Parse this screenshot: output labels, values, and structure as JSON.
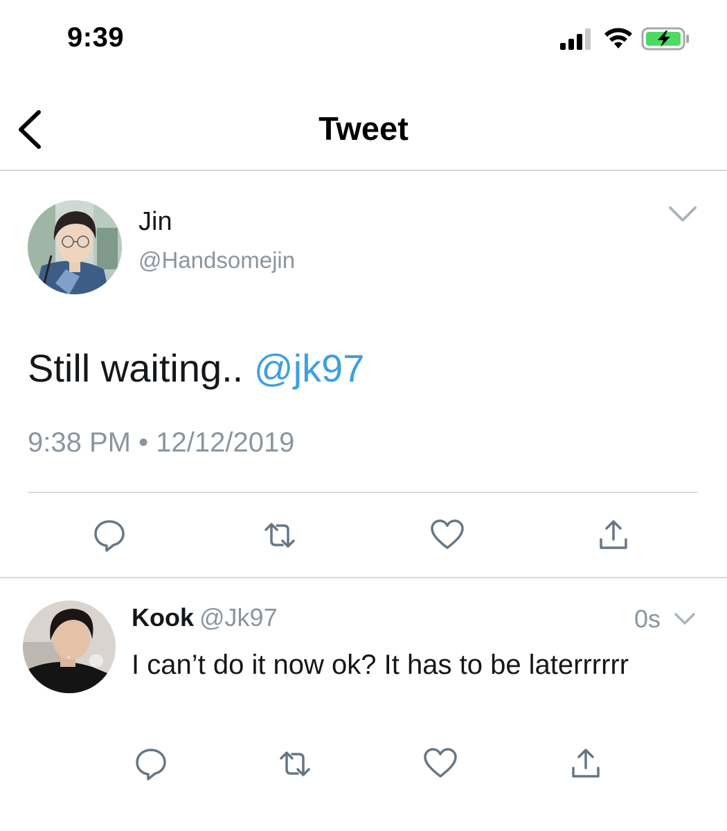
{
  "status_bar": {
    "time": "9:39",
    "icons": [
      "signal-bars-icon",
      "wifi-icon",
      "battery-charging-icon"
    ],
    "battery_color": "#4cd964"
  },
  "header": {
    "title": "Tweet",
    "back_icon": "chevron-left-icon"
  },
  "tweet": {
    "author_name": "Jin",
    "author_handle": "@Handsomejin",
    "text": "Still waiting..",
    "mention": "@jk97",
    "time": "9:38 PM",
    "separator": "•",
    "date": "12/12/2019",
    "actions": [
      "reply-icon",
      "retweet-icon",
      "like-icon",
      "share-icon"
    ]
  },
  "reply": {
    "author_name": "Kook",
    "author_handle": "@Jk97",
    "time_ago": "0s",
    "text": "I can’t do it now ok? It has to be laterrrrrr",
    "actions": [
      "reply-icon",
      "retweet-icon",
      "like-icon",
      "share-icon"
    ]
  },
  "colors": {
    "mention": "#3f9fe0",
    "secondary_text": "#8a959e",
    "icon": "#657786",
    "divider": "#d6d6d6"
  }
}
